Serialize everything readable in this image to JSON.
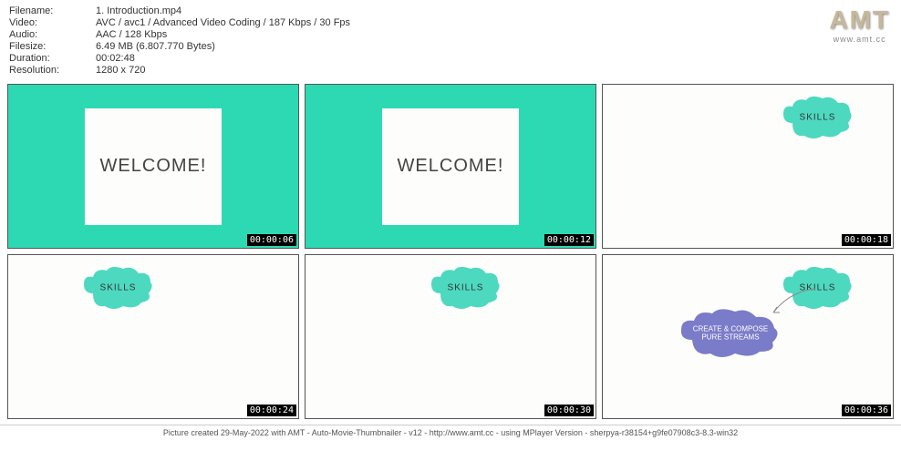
{
  "header": {
    "filename_label": "Filename:",
    "filename": "1. Introduction.mp4",
    "video_label": "Video:",
    "video": "AVC / avc1 / Advanced Video Coding / 187 Kbps / 30 Fps",
    "audio_label": "Audio:",
    "audio": "AAC / 128 Kbps",
    "filesize_label": "Filesize:",
    "filesize": "6.49 MB (6.807.770 Bytes)",
    "duration_label": "Duration:",
    "duration": "00:02:48",
    "resolution_label": "Resolution:",
    "resolution": "1280 x 720"
  },
  "logo": {
    "text": "AMT",
    "url": "www.amt.cc"
  },
  "thumbs": [
    {
      "ts": "00:00:06",
      "welcome": "WELCOME!"
    },
    {
      "ts": "00:00:12",
      "welcome": "WELCOME!"
    },
    {
      "ts": "00:00:18",
      "skills": "SKILLS"
    },
    {
      "ts": "00:00:24",
      "skills": "SKILLS"
    },
    {
      "ts": "00:00:30",
      "skills": "SKILLS"
    },
    {
      "ts": "00:00:36",
      "skills": "SKILLS",
      "purple": "CREATE & COMPOSE\nPURE STREAMS"
    }
  ],
  "footer": "Picture created 29-May-2022 with AMT - Auto-Movie-Thumbnailer - v12 - http://www.amt.cc - using MPlayer Version - sherpya-r38154+g9fe07908c3-8.3-win32"
}
